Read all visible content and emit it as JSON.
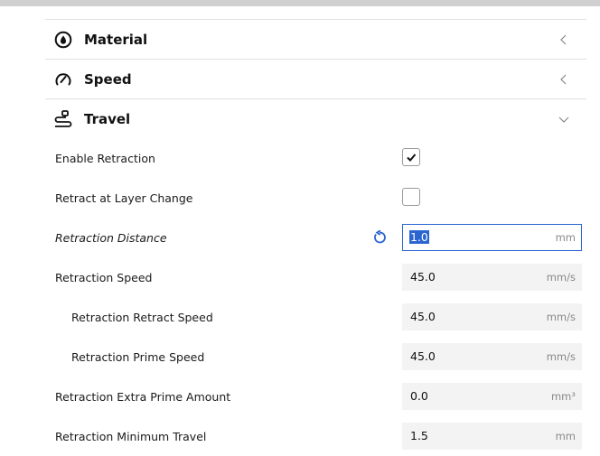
{
  "categories": [
    {
      "label": "Material",
      "icon": "material-icon",
      "expanded": false
    },
    {
      "label": "Speed",
      "icon": "speed-icon",
      "expanded": false
    },
    {
      "label": "Travel",
      "icon": "travel-icon",
      "expanded": true
    }
  ],
  "settings": {
    "enable_retraction": {
      "label": "Enable Retraction",
      "checked": true
    },
    "retract_layer_change": {
      "label": "Retract at Layer Change",
      "checked": false
    },
    "retraction_distance": {
      "label": "Retraction Distance",
      "value": "1.0",
      "unit": "mm"
    },
    "retraction_speed": {
      "label": "Retraction Speed",
      "value": "45.0",
      "unit": "mm/s"
    },
    "retraction_retract_speed": {
      "label": "Retraction Retract Speed",
      "value": "45.0",
      "unit": "mm/s"
    },
    "retraction_prime_speed": {
      "label": "Retraction Prime Speed",
      "value": "45.0",
      "unit": "mm/s"
    },
    "retraction_extra_prime": {
      "label": "Retraction Extra Prime Amount",
      "value": "0.0",
      "unit": "mm³"
    },
    "retraction_min_travel": {
      "label": "Retraction Minimum Travel",
      "value": "1.5",
      "unit": "mm"
    }
  },
  "colors": {
    "accent": "#2a65d1",
    "field_bg": "#f3f3f3",
    "divider": "#e0e0e0"
  }
}
